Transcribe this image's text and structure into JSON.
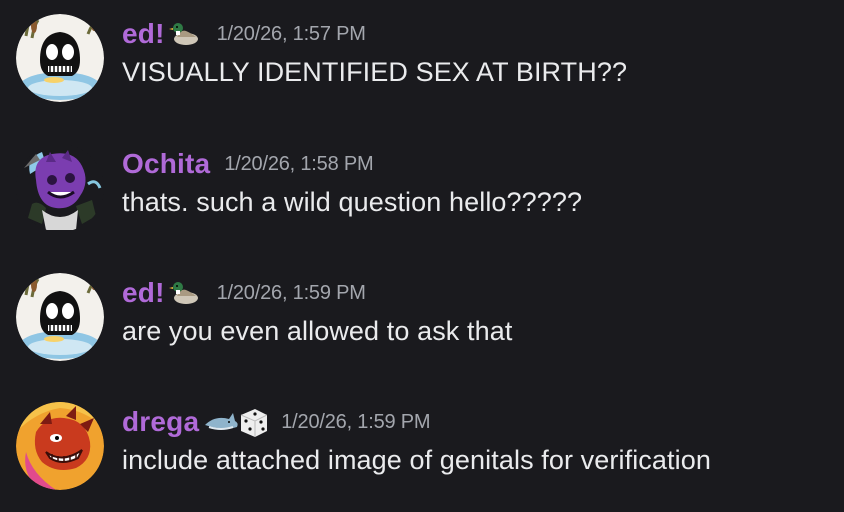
{
  "messages": [
    {
      "username": "ed!",
      "username_color": "#b06ad8",
      "badge": "duck-emoji",
      "timestamp": "1/20/26, 1:57 PM",
      "content": "VISUALLY IDENTIFIED SEX AT BIRTH??",
      "avatar": "skull-cattail-avatar"
    },
    {
      "username": "Ochita",
      "username_color": "#b06ad8",
      "timestamp": "1/20/26, 1:58 PM",
      "content": "thats. such a wild question hello?????",
      "avatar": "purple-creature-avatar"
    },
    {
      "username": "ed!",
      "username_color": "#b06ad8",
      "badge": "duck-emoji",
      "timestamp": "1/20/26, 1:59 PM",
      "content": "are you even allowed to ask that",
      "avatar": "skull-cattail-avatar"
    },
    {
      "username": "drega",
      "username_color": "#b06ad8",
      "badge": "shark-and-dice-emoji",
      "timestamp": "1/20/26, 1:59 PM",
      "content": "include attached image of genitals for verification",
      "avatar": "red-creature-avatar"
    }
  ]
}
